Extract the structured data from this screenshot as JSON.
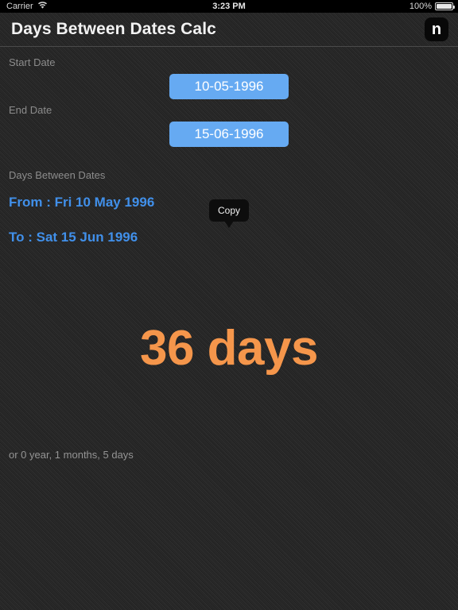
{
  "statusbar": {
    "carrier": "Carrier",
    "wifi_icon": "wifi-icon",
    "time": "3:23 PM",
    "battery_percent": "100%",
    "battery_icon": "battery-full-icon"
  },
  "navbar": {
    "title": "Days Between Dates Calc",
    "logo_label": "n"
  },
  "form": {
    "start_label": "Start Date",
    "start_value": "10-05-1996",
    "end_label": "End Date",
    "end_value": "15-06-1996"
  },
  "result": {
    "section_label": "Days Between Dates",
    "from_line": "From : Fri 10 May 1996",
    "to_line": "To : Sat 15 Jun 1996",
    "days_total": "36 days",
    "breakdown": "or 0 year, 1 months, 5 days"
  },
  "tooltip": {
    "label": "Copy"
  },
  "colors": {
    "background": "#262626",
    "accent_blue": "#66aaf2",
    "text_blue": "#4190ea",
    "accent_orange": "#f5964b",
    "muted_text": "#8c8c8c"
  }
}
